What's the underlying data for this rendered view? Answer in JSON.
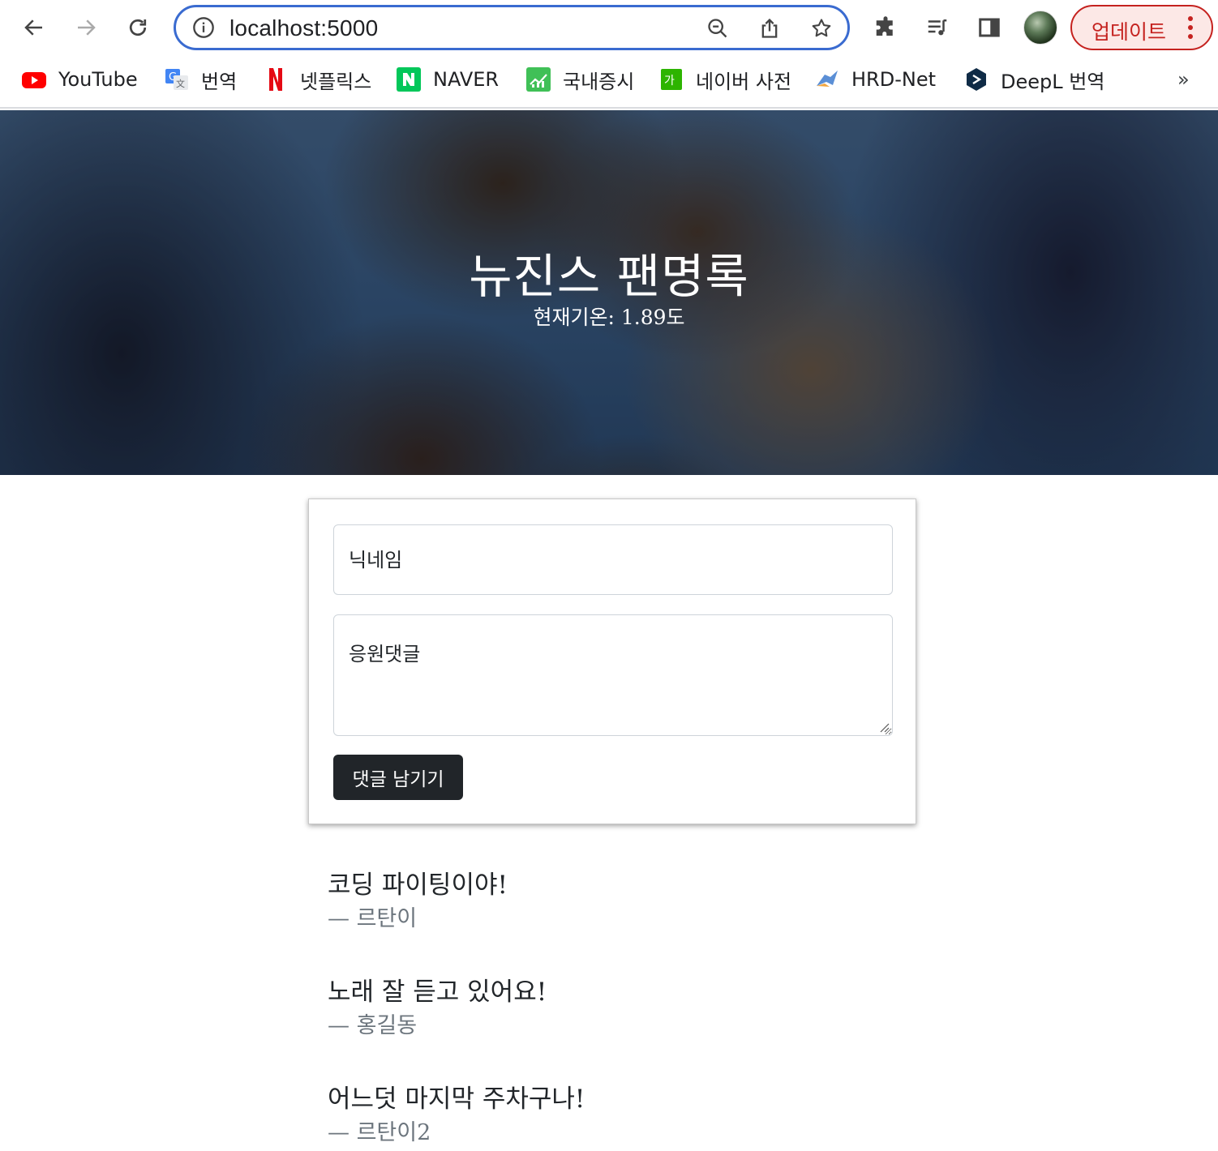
{
  "browser": {
    "url": "localhost:5000",
    "update_label": "업데이트",
    "bookmarks": [
      {
        "label": "YouTube",
        "icon": "youtube-icon"
      },
      {
        "label": "번역",
        "icon": "translate-icon"
      },
      {
        "label": "넷플릭스",
        "icon": "netflix-icon"
      },
      {
        "label": "NAVER",
        "icon": "naver-icon"
      },
      {
        "label": "국내증시",
        "icon": "stock-icon"
      },
      {
        "label": "네이버 사전",
        "icon": "dictionary-icon"
      },
      {
        "label": "HRD-Net",
        "icon": "hrdnet-icon"
      },
      {
        "label": "DeepL 번역",
        "icon": "deepl-icon"
      }
    ],
    "more_bookmarks": "»"
  },
  "hero": {
    "title": "뉴진스 팬명록",
    "weather": "현재기온: 1.89도"
  },
  "form": {
    "nickname_placeholder": "닉네임",
    "comment_placeholder": "응원댓글",
    "submit_label": "댓글 남기기"
  },
  "comments": [
    {
      "text": "코딩 파이팅이야!",
      "author": "— 르탄이"
    },
    {
      "text": "노래 잘 듣고 있어요!",
      "author": "— 홍길동"
    },
    {
      "text": "어느덧 마지막 주차구나!",
      "author": "— 르탄이2"
    }
  ],
  "colors": {
    "accent_blue": "#3a6bd0",
    "update_red": "#c5221f",
    "button_dark": "#212529",
    "muted_text": "#6c757d"
  }
}
